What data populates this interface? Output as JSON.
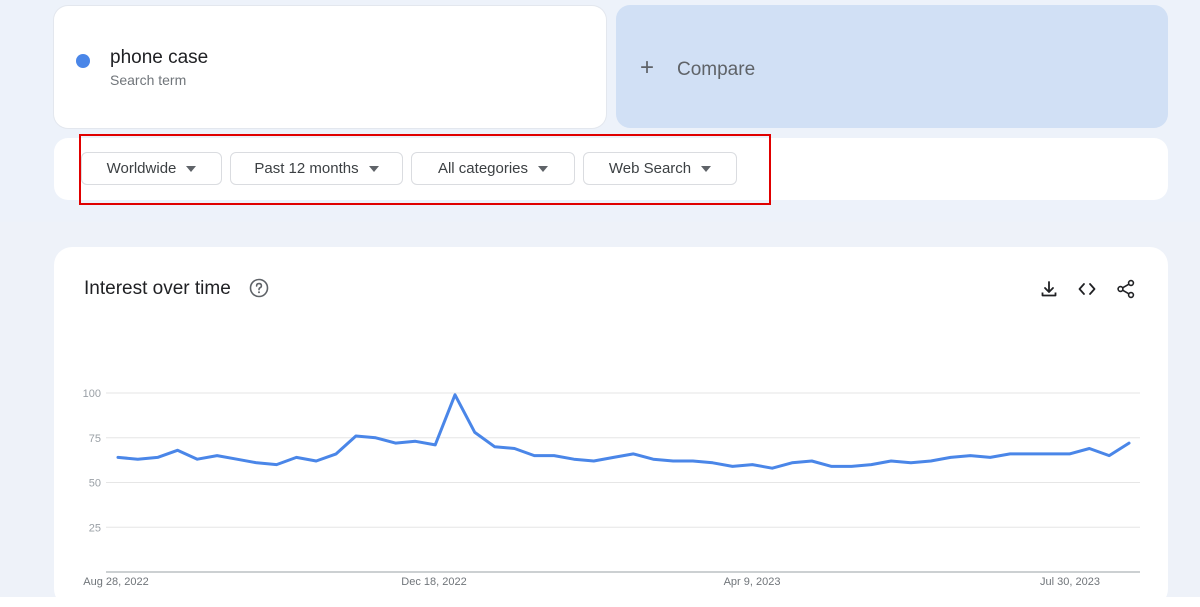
{
  "search_term": {
    "name": "phone case",
    "subtitle": "Search term",
    "color": "#4a86e8"
  },
  "compare": {
    "label": "Compare"
  },
  "filters": {
    "region": "Worldwide",
    "time_range": "Past 12 months",
    "category": "All categories",
    "search_type": "Web Search"
  },
  "chart_section": {
    "title": "Interest over time",
    "icons": [
      "help-icon",
      "download-icon",
      "embed-icon",
      "share-icon"
    ]
  },
  "chart_data": {
    "type": "line",
    "title": "Interest over time",
    "xlabel": "",
    "ylabel": "",
    "ylim": [
      0,
      100
    ],
    "yticks": [
      "100",
      "75",
      "50",
      "25"
    ],
    "xticks": [
      "Aug 28, 2022",
      "Dec 18, 2022",
      "Apr 9, 2023",
      "Jul 30, 2023"
    ],
    "x_start": "Aug 28, 2022",
    "grid": true,
    "series": [
      {
        "name": "phone case",
        "color": "#4a86e8",
        "values": [
          64,
          63,
          64,
          68,
          63,
          65,
          63,
          61,
          60,
          64,
          62,
          66,
          76,
          75,
          72,
          73,
          71,
          99,
          78,
          70,
          69,
          65,
          65,
          63,
          62,
          64,
          66,
          63,
          62,
          62,
          61,
          59,
          60,
          58,
          61,
          62,
          59,
          59,
          60,
          62,
          61,
          62,
          64,
          65,
          64,
          66,
          66,
          66,
          66,
          69,
          65,
          72
        ]
      }
    ]
  }
}
